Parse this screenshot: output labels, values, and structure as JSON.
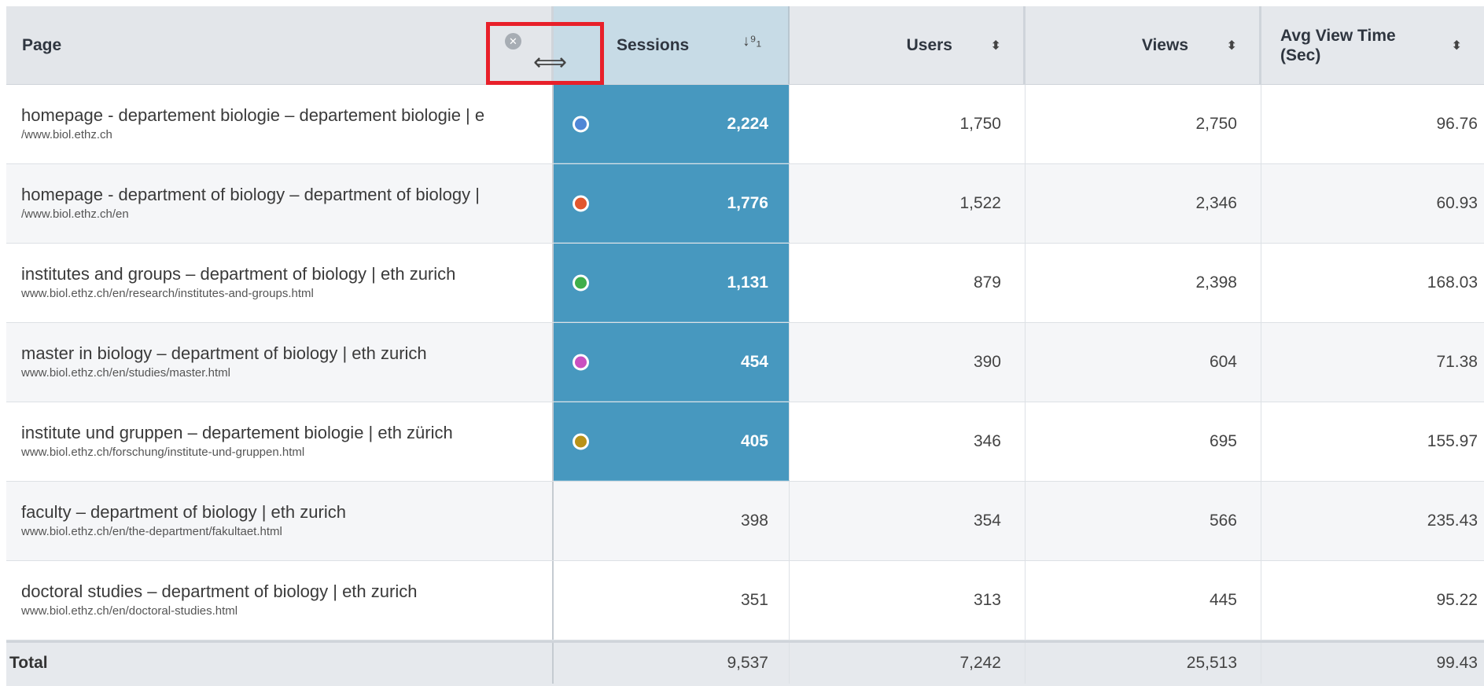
{
  "headers": {
    "page": "Page",
    "sessions": "Sessions",
    "users": "Users",
    "views": "Views",
    "avg_view_time": "Avg View Time (Sec)"
  },
  "icons": {
    "sort_both": "sort-both-icon",
    "sort_desc": "sort-numeric-desc-icon",
    "close": "close-circle-icon",
    "resize": "resize-horizontal-icon"
  },
  "colors": {
    "selected_column": "#4798bf",
    "highlight_box": "#e8202a"
  },
  "rows": [
    {
      "title": "homepage - departement biologie – departement biologie | e",
      "url": "/www.biol.ethz.ch",
      "sessions": "2,224",
      "users": "1,750",
      "views": "2,750",
      "avg": "96.76",
      "selected": true,
      "dot": "#4f86d6"
    },
    {
      "title": "homepage - department of biology – department of biology |",
      "url": "/www.biol.ethz.ch/en",
      "sessions": "1,776",
      "users": "1,522",
      "views": "2,346",
      "avg": "60.93",
      "selected": true,
      "dot": "#e2572e"
    },
    {
      "title": "institutes and groups – department of biology | eth zurich",
      "url": "www.biol.ethz.ch/en/research/institutes-and-groups.html",
      "sessions": "1,131",
      "users": "879",
      "views": "2,398",
      "avg": "168.03",
      "selected": true,
      "dot": "#3fae4a"
    },
    {
      "title": "master in biology – department of biology | eth zurich",
      "url": "www.biol.ethz.ch/en/studies/master.html",
      "sessions": "454",
      "users": "390",
      "views": "604",
      "avg": "71.38",
      "selected": true,
      "dot": "#c94fc0"
    },
    {
      "title": "institute und gruppen – departement biologie | eth zürich",
      "url": "www.biol.ethz.ch/forschung/institute-und-gruppen.html",
      "sessions": "405",
      "users": "346",
      "views": "695",
      "avg": "155.97",
      "selected": true,
      "dot": "#b89219"
    },
    {
      "title": "faculty – department of biology | eth zurich",
      "url": "www.biol.ethz.ch/en/the-department/fakultaet.html",
      "sessions": "398",
      "users": "354",
      "views": "566",
      "avg": "235.43",
      "selected": false,
      "dot": ""
    },
    {
      "title": "doctoral studies – department of biology | eth zurich",
      "url": "www.biol.ethz.ch/en/doctoral-studies.html",
      "sessions": "351",
      "users": "313",
      "views": "445",
      "avg": "95.22",
      "selected": false,
      "dot": ""
    }
  ],
  "total": {
    "label": "Total",
    "sessions": "9,537",
    "users": "7,242",
    "views": "25,513",
    "avg": "99.43"
  }
}
